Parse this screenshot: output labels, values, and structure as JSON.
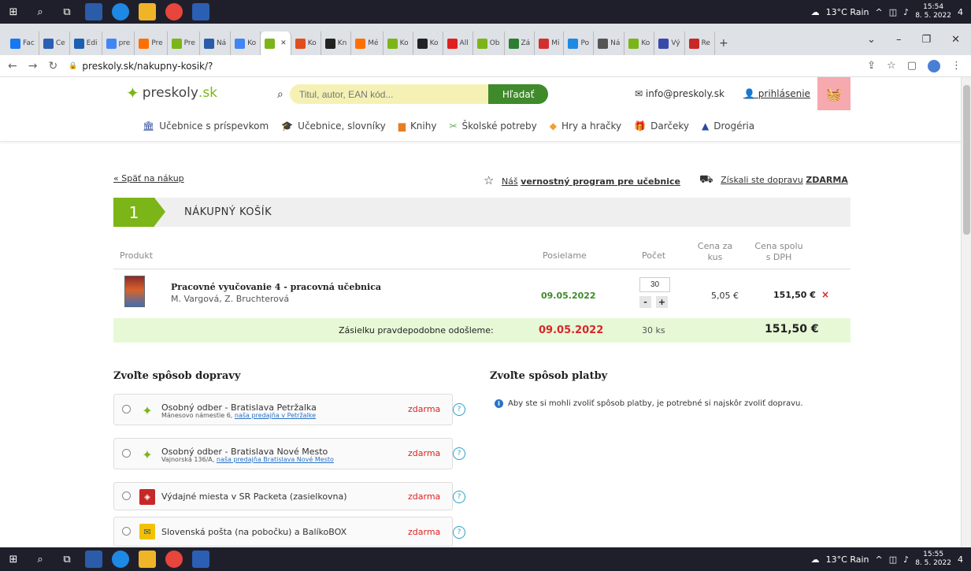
{
  "taskbar": {
    "weather": "13°C Rain",
    "top_time": "15:54",
    "top_date": "8. 5. 2022",
    "bottom_time": "15:55",
    "bottom_date": "8. 5. 2022",
    "notif_count": "4"
  },
  "tabs": [
    {
      "label": "Fac",
      "color": "#1877f2"
    },
    {
      "label": "Ce",
      "color": "#2b5fb3"
    },
    {
      "label": "Edi",
      "color": "#1a5fb4"
    },
    {
      "label": "pre",
      "color": "#4285f4"
    },
    {
      "label": "Pre",
      "color": "#ff6f00"
    },
    {
      "label": "Pre",
      "color": "#7cb518"
    },
    {
      "label": "Ná",
      "color": "#2a5caa"
    },
    {
      "label": "Ko",
      "color": "#4285f4"
    },
    {
      "label": "",
      "color": "#7cb518",
      "active": true
    },
    {
      "label": "Ko",
      "color": "#e04e1c"
    },
    {
      "label": "Kn",
      "color": "#222222"
    },
    {
      "label": "Mé",
      "color": "#ff6f00"
    },
    {
      "label": "Ko",
      "color": "#7cb518"
    },
    {
      "label": "Ko",
      "color": "#222222"
    },
    {
      "label": "All",
      "color": "#e02020"
    },
    {
      "label": "Ob",
      "color": "#7cb518"
    },
    {
      "label": "Zá",
      "color": "#2e7d32"
    },
    {
      "label": "Mi",
      "color": "#d32f2f"
    },
    {
      "label": "Po",
      "color": "#1e88e5"
    },
    {
      "label": "Ná",
      "color": "#555555"
    },
    {
      "label": "Ko",
      "color": "#7cb518"
    },
    {
      "label": "Vý",
      "color": "#3949ab"
    },
    {
      "label": "Re",
      "color": "#c62828"
    }
  ],
  "address": {
    "url": "preskoly.sk/nakupny-kosik/?"
  },
  "header": {
    "logo_main": "preskoly",
    "logo_tld": ".sk",
    "search_placeholder": "Titul, autor, EAN kód...",
    "search_button": "Hľadať",
    "email": "info@preskoly.sk",
    "login": "prihlásenie"
  },
  "categories": [
    {
      "label": "Učebnice s príspevkom",
      "icon": "bank-icon",
      "glyph": "🏛",
      "color": "#2b4a9b"
    },
    {
      "label": "Učebnice, slovníky",
      "icon": "graduation-cap-icon",
      "glyph": "🎓",
      "color": "#7cb518"
    },
    {
      "label": "Knihy",
      "icon": "book-icon",
      "glyph": "▆",
      "color": "#e67e22"
    },
    {
      "label": "Školské potreby",
      "icon": "scissors-icon",
      "glyph": "✂",
      "color": "#6aa84f"
    },
    {
      "label": "Hry a hračky",
      "icon": "puzzle-icon",
      "glyph": "◆",
      "color": "#f0a030"
    },
    {
      "label": "Darčeky",
      "icon": "gift-icon",
      "glyph": "🎁",
      "color": "#e02020"
    },
    {
      "label": "Drogéria",
      "icon": "bottle-icon",
      "glyph": "▲",
      "color": "#2b4a9b"
    }
  ],
  "cart": {
    "back_link": "« Späť na nákup",
    "loyalty_prefix": "Náš",
    "loyalty_bold": "vernostný program pre učebnice",
    "shipping_prefix": "Získali ste dopravu",
    "shipping_bold": "ZDARMA",
    "step_number": "1",
    "step_label": "NÁKUPNÝ KOŠÍK",
    "columns": {
      "product": "Produkt",
      "ship": "Posielame",
      "qty": "Počet",
      "unit_line1": "Cena za",
      "unit_line2": "kus",
      "total_line1": "Cena spolu",
      "total_line2": "s DPH"
    },
    "item": {
      "title": "Pracovné vyučovanie 4 - pracovná učebnica",
      "author": "M. Vargová, Z. Bruchterová",
      "ship_date": "09.05.2022",
      "qty": "30",
      "minus": "-",
      "plus": "+",
      "unit_price": "5,05 €",
      "total": "151,50 €",
      "remove": "×"
    },
    "summary": {
      "label": "Zásielku pravdepodobne odošleme:",
      "date": "09.05.2022",
      "qty": "30 ks",
      "total": "151,50 €"
    }
  },
  "shipping": {
    "title": "Zvoľte spôsob dopravy",
    "options": [
      {
        "name": "Osobný odber - Bratislava Petržalka",
        "addr": "Mánesovo námestie 6,",
        "link": "naša predajňa v Petržalke",
        "price": "zdarma"
      },
      {
        "name": "Osobný odber - Bratislava Nové Mesto",
        "addr": "Vajnorská 136/A,",
        "link": "naša predajňa Bratislava Nové Mesto",
        "price": "zdarma"
      },
      {
        "name": "Výdajné miesta v SR Packeta (zasielkovna)",
        "price": "zdarma"
      },
      {
        "name": "Slovenská pošta (na pobočku) a BalíkoBOX",
        "price": "zdarma"
      }
    ]
  },
  "payment": {
    "title": "Zvoľte spôsob platby",
    "note": "Aby ste si mohli zvoliť spôsob platby, je potrebné si najskôr zvoliť dopravu."
  }
}
